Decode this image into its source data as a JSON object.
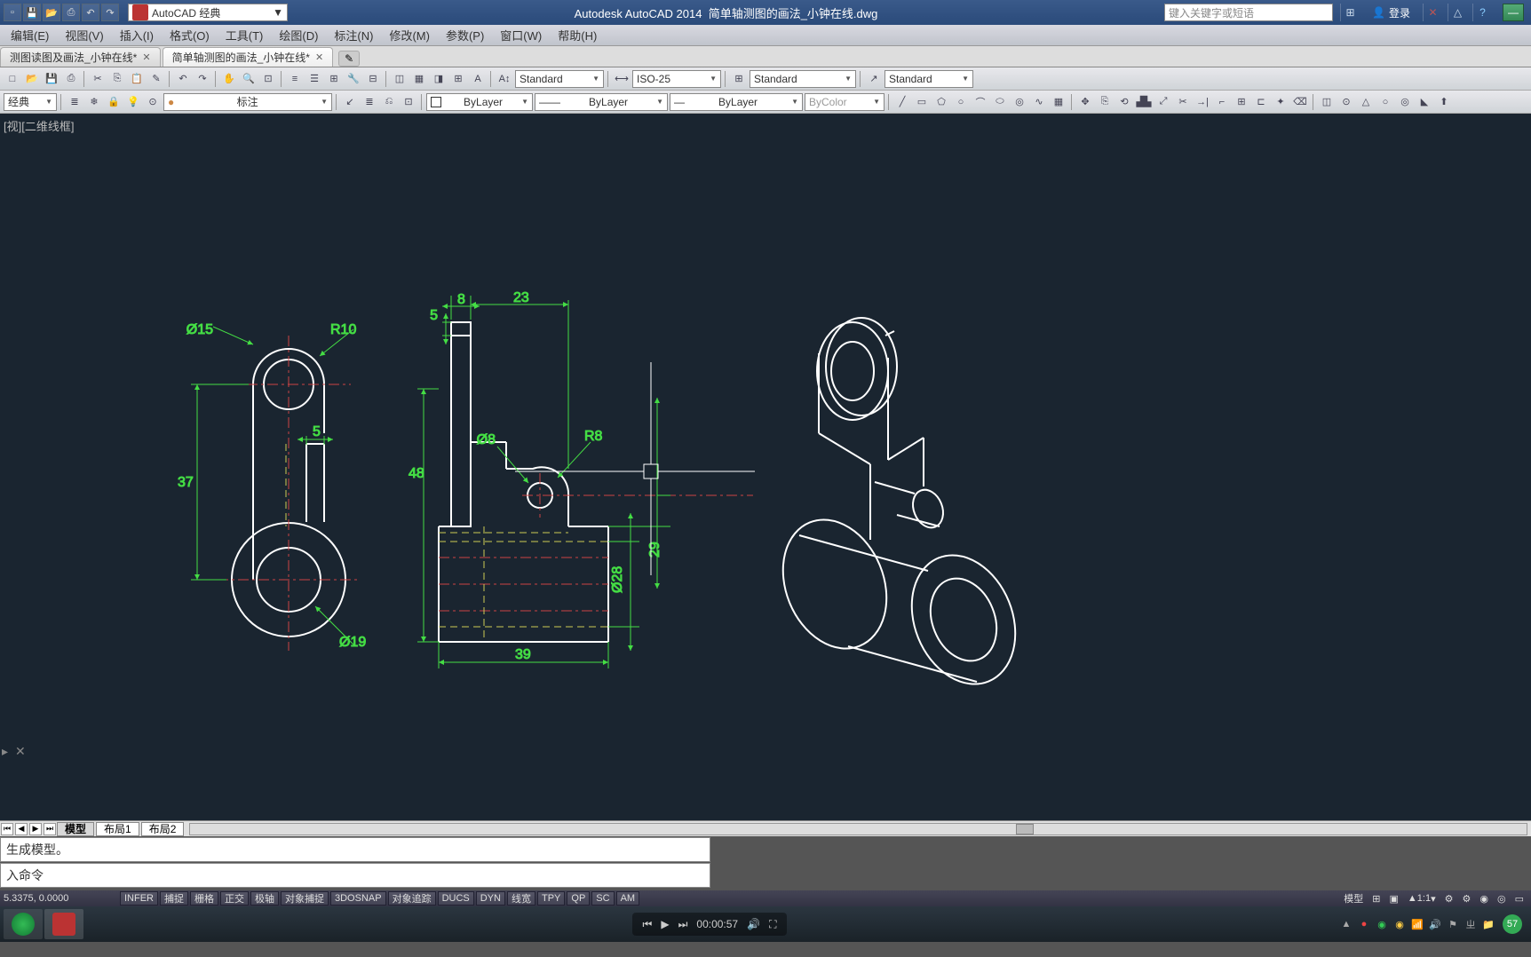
{
  "title": {
    "workspace": "AutoCAD 经典",
    "app": "Autodesk AutoCAD 2014",
    "file": "简单轴测图的画法_小钟在线.dwg",
    "search_placeholder": "键入关键字或短语",
    "login": "登录"
  },
  "menu": [
    "编辑(E)",
    "视图(V)",
    "插入(I)",
    "格式(O)",
    "工具(T)",
    "绘图(D)",
    "标注(N)",
    "修改(M)",
    "参数(P)",
    "窗口(W)",
    "帮助(H)"
  ],
  "tabs": {
    "items": [
      {
        "label": "测图读图及画法_小钟在线*",
        "active": false
      },
      {
        "label": "简单轴测图的画法_小钟在线*",
        "active": true
      }
    ]
  },
  "toolbar1": {
    "text_style": "Standard",
    "dim_style": "ISO-25",
    "table_style": "Standard",
    "mleader_style": "Standard"
  },
  "toolbar2": {
    "layer": "经典",
    "annot": "标注",
    "linetype": "ByLayer",
    "lineweight": "ByLayer",
    "color": "ByLayer",
    "plotstyle": "ByColor"
  },
  "view_label": "[视][二维线框]",
  "layout": {
    "tabs": [
      "模型",
      "布局1",
      "布局2"
    ],
    "active": 0
  },
  "cmd": {
    "hist": "生成模型。",
    "prompt": "入命令"
  },
  "status": {
    "coords": "5.3375, 0.0000",
    "btns": [
      "INFER",
      "捕捉",
      "栅格",
      "正交",
      "极轴",
      "对象捕捉",
      "3DOSNAP",
      "对象追踪",
      "DUCS",
      "DYN",
      "线宽",
      "TPY",
      "QP",
      "SC",
      "AM"
    ],
    "model": "模型",
    "scale": "1:1"
  },
  "taskbar": {
    "time": "00:00:57"
  },
  "tray": {
    "badge": "57"
  },
  "dims": {
    "d15": "Ø15",
    "r10": "R10",
    "n5": "5",
    "n37": "37",
    "d19": "Ø19",
    "n8": "8",
    "n5b": "5",
    "n23": "23",
    "n48": "48",
    "d8": "Ø8",
    "r8": "R8",
    "n29": "29",
    "d28": "Ø28",
    "n39": "39"
  }
}
